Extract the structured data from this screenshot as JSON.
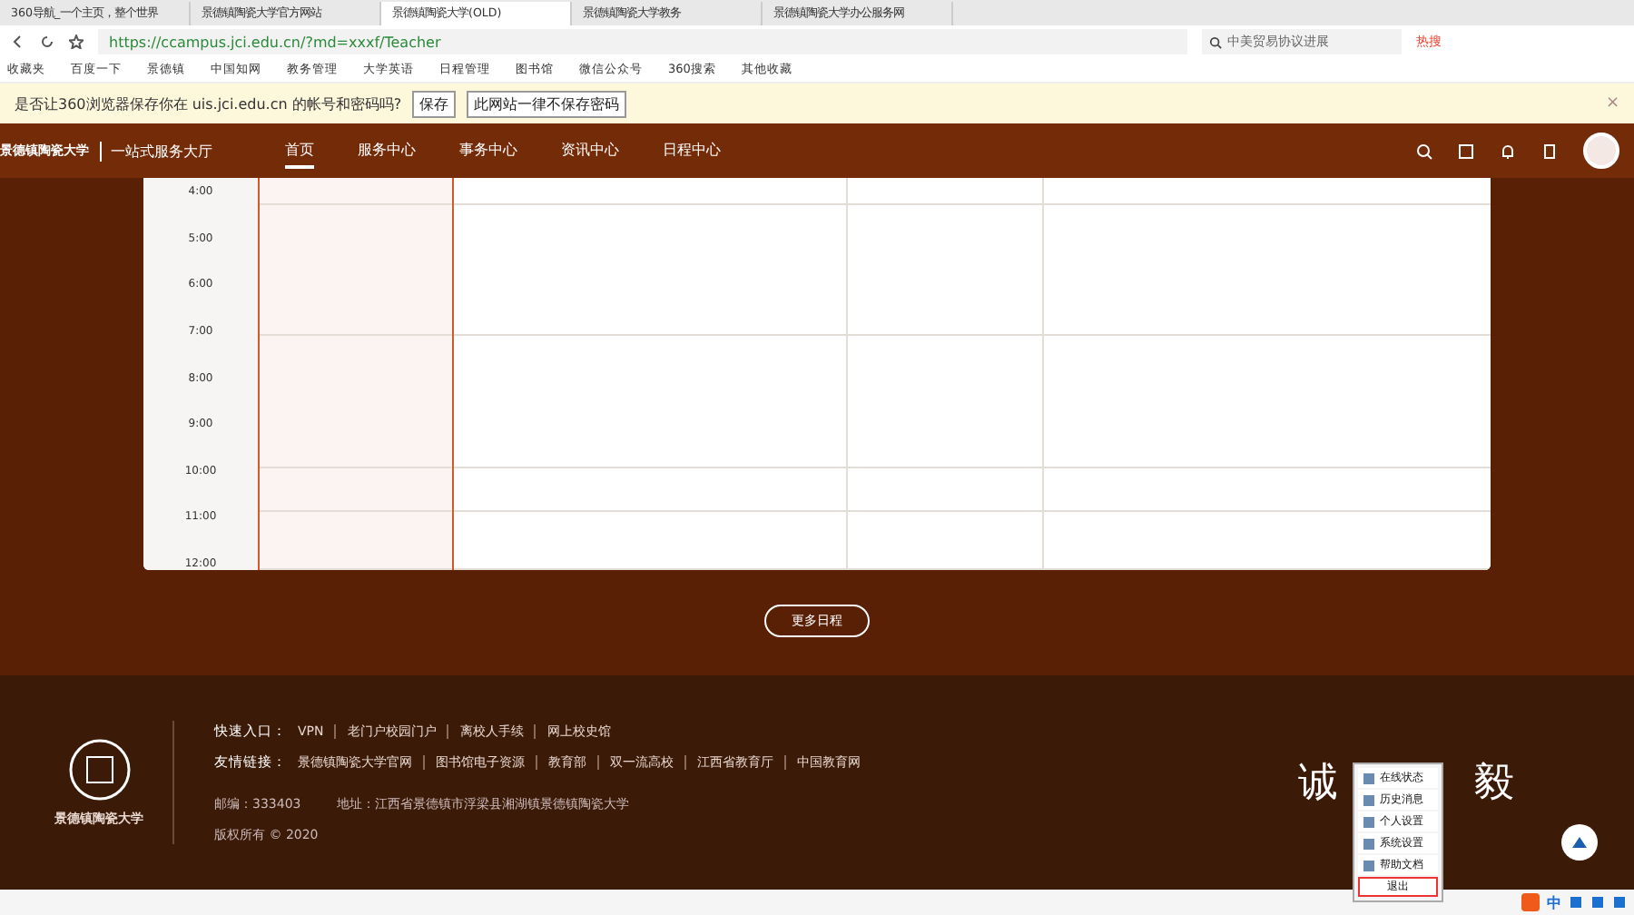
{
  "browser": {
    "tabs": [
      {
        "title": "360导航_一个主页，整个世界",
        "selected": false
      },
      {
        "title": "景德镇陶瓷大学官方网站",
        "selected": false
      },
      {
        "title": "景德镇陶瓷大学(OLD)",
        "selected": true
      },
      {
        "title": "景德镇陶瓷大学教务",
        "selected": false
      },
      {
        "title": "景德镇陶瓷大学办公服务网",
        "selected": false
      }
    ],
    "url": "https://ccampus.jci.edu.cn/?md=xxxf/Teacher",
    "search_placeholder": "中美贸易协议进展",
    "hot_label": "热搜",
    "bookmarks": [
      "收藏夹",
      "百度一下",
      "景德镇",
      "中国知网",
      "教务管理",
      "大学英语",
      "日程管理",
      "图书馆",
      "微信公众号",
      "360搜索",
      "其他收藏"
    ]
  },
  "save_bar": {
    "message": "是否让360浏览器保存你在 uis.jci.edu.cn 的帐号和密码吗?",
    "buttons": [
      "保存",
      "此网站一律不保存密码"
    ],
    "close": "×"
  },
  "header": {
    "logo": "景德镇陶瓷大学",
    "subtitle": "一站式服务大厅",
    "nav": [
      {
        "label": "首页",
        "selected": true
      },
      {
        "label": "服务中心",
        "selected": false
      },
      {
        "label": "事务中心",
        "selected": false
      },
      {
        "label": "资讯中心",
        "selected": false
      },
      {
        "label": "日程中心",
        "selected": false
      }
    ]
  },
  "schedule": {
    "times": [
      "4:00",
      "5:00",
      "6:00",
      "7:00",
      "8:00",
      "9:00",
      "10:00",
      "11:00",
      "12:00"
    ]
  },
  "more_button": "更多日程",
  "footer": {
    "logo": "景德镇陶瓷大学",
    "quick_label": "快速入口：",
    "quick_links": [
      "VPN",
      "老门户校园门户",
      "离校人手续",
      "网上校史馆"
    ],
    "friend_label": "友情链接：",
    "friend_links": [
      "景德镇陶瓷大学官网",
      "图书馆电子资源",
      "教育部",
      "双一流高校",
      "江西省教育厅",
      "中国教育网"
    ],
    "postcode": "邮编：333403",
    "address": "地址：江西省景德镇市浮梁县湘湖镇景德镇陶瓷大学",
    "copyright": "版权所有 © 2020",
    "motto_left": "诚",
    "motto_right": "毅"
  },
  "tray_menu": {
    "items": [
      {
        "label": "在线状态",
        "kind": "item",
        "selected": false
      },
      {
        "label": "历史消息",
        "kind": "item",
        "selected": false
      },
      {
        "label": "个人设置",
        "kind": "item",
        "selected": false
      },
      {
        "label": "系统设置",
        "kind": "item",
        "selected": false
      },
      {
        "label": "帮助文档",
        "kind": "item",
        "selected": false
      },
      {
        "label": "退出",
        "kind": "exit",
        "selected": true
      }
    ]
  },
  "tray": {
    "ime": "中"
  }
}
